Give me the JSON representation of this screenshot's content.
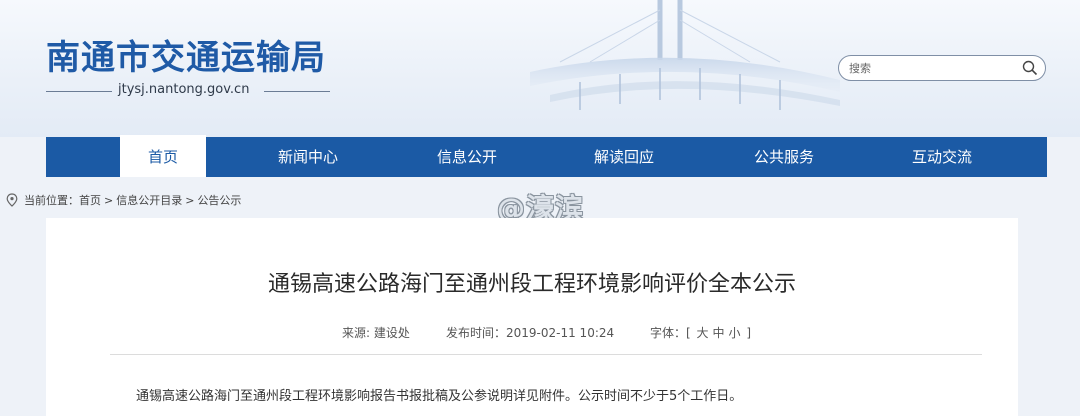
{
  "header": {
    "site_title": "南通市交通运输局",
    "domain": "jtysj.nantong.gov.cn",
    "search_placeholder": "搜索"
  },
  "nav": {
    "items": [
      "首页",
      "新闻中心",
      "信息公开",
      "解读回应",
      "公共服务",
      "互动交流"
    ],
    "active_index": 0
  },
  "breadcrumb": {
    "label": "当前位置：",
    "items": [
      "首页",
      "信息公开目录",
      "公告公示"
    ],
    "separator": ">"
  },
  "watermark": "@濠滨",
  "article": {
    "title": "通锡高速公路海门至通州段工程环境影响评价全本公示",
    "source": "来源: 建设处",
    "publish_time": "发布时间：2019-02-11 10:24",
    "font_label": "字体：[",
    "font_large": "大",
    "font_medium": "中",
    "font_small": "小",
    "font_close": "]",
    "body": "通锡高速公路海门至通州段工程环境影响报告书报批稿及公参说明详见附件。公示时间不少于5个工作日。"
  },
  "colors": {
    "brand_blue": "#1b5aa5",
    "title_blue": "#1f5aa6",
    "page_bg": "#eef2f8"
  }
}
